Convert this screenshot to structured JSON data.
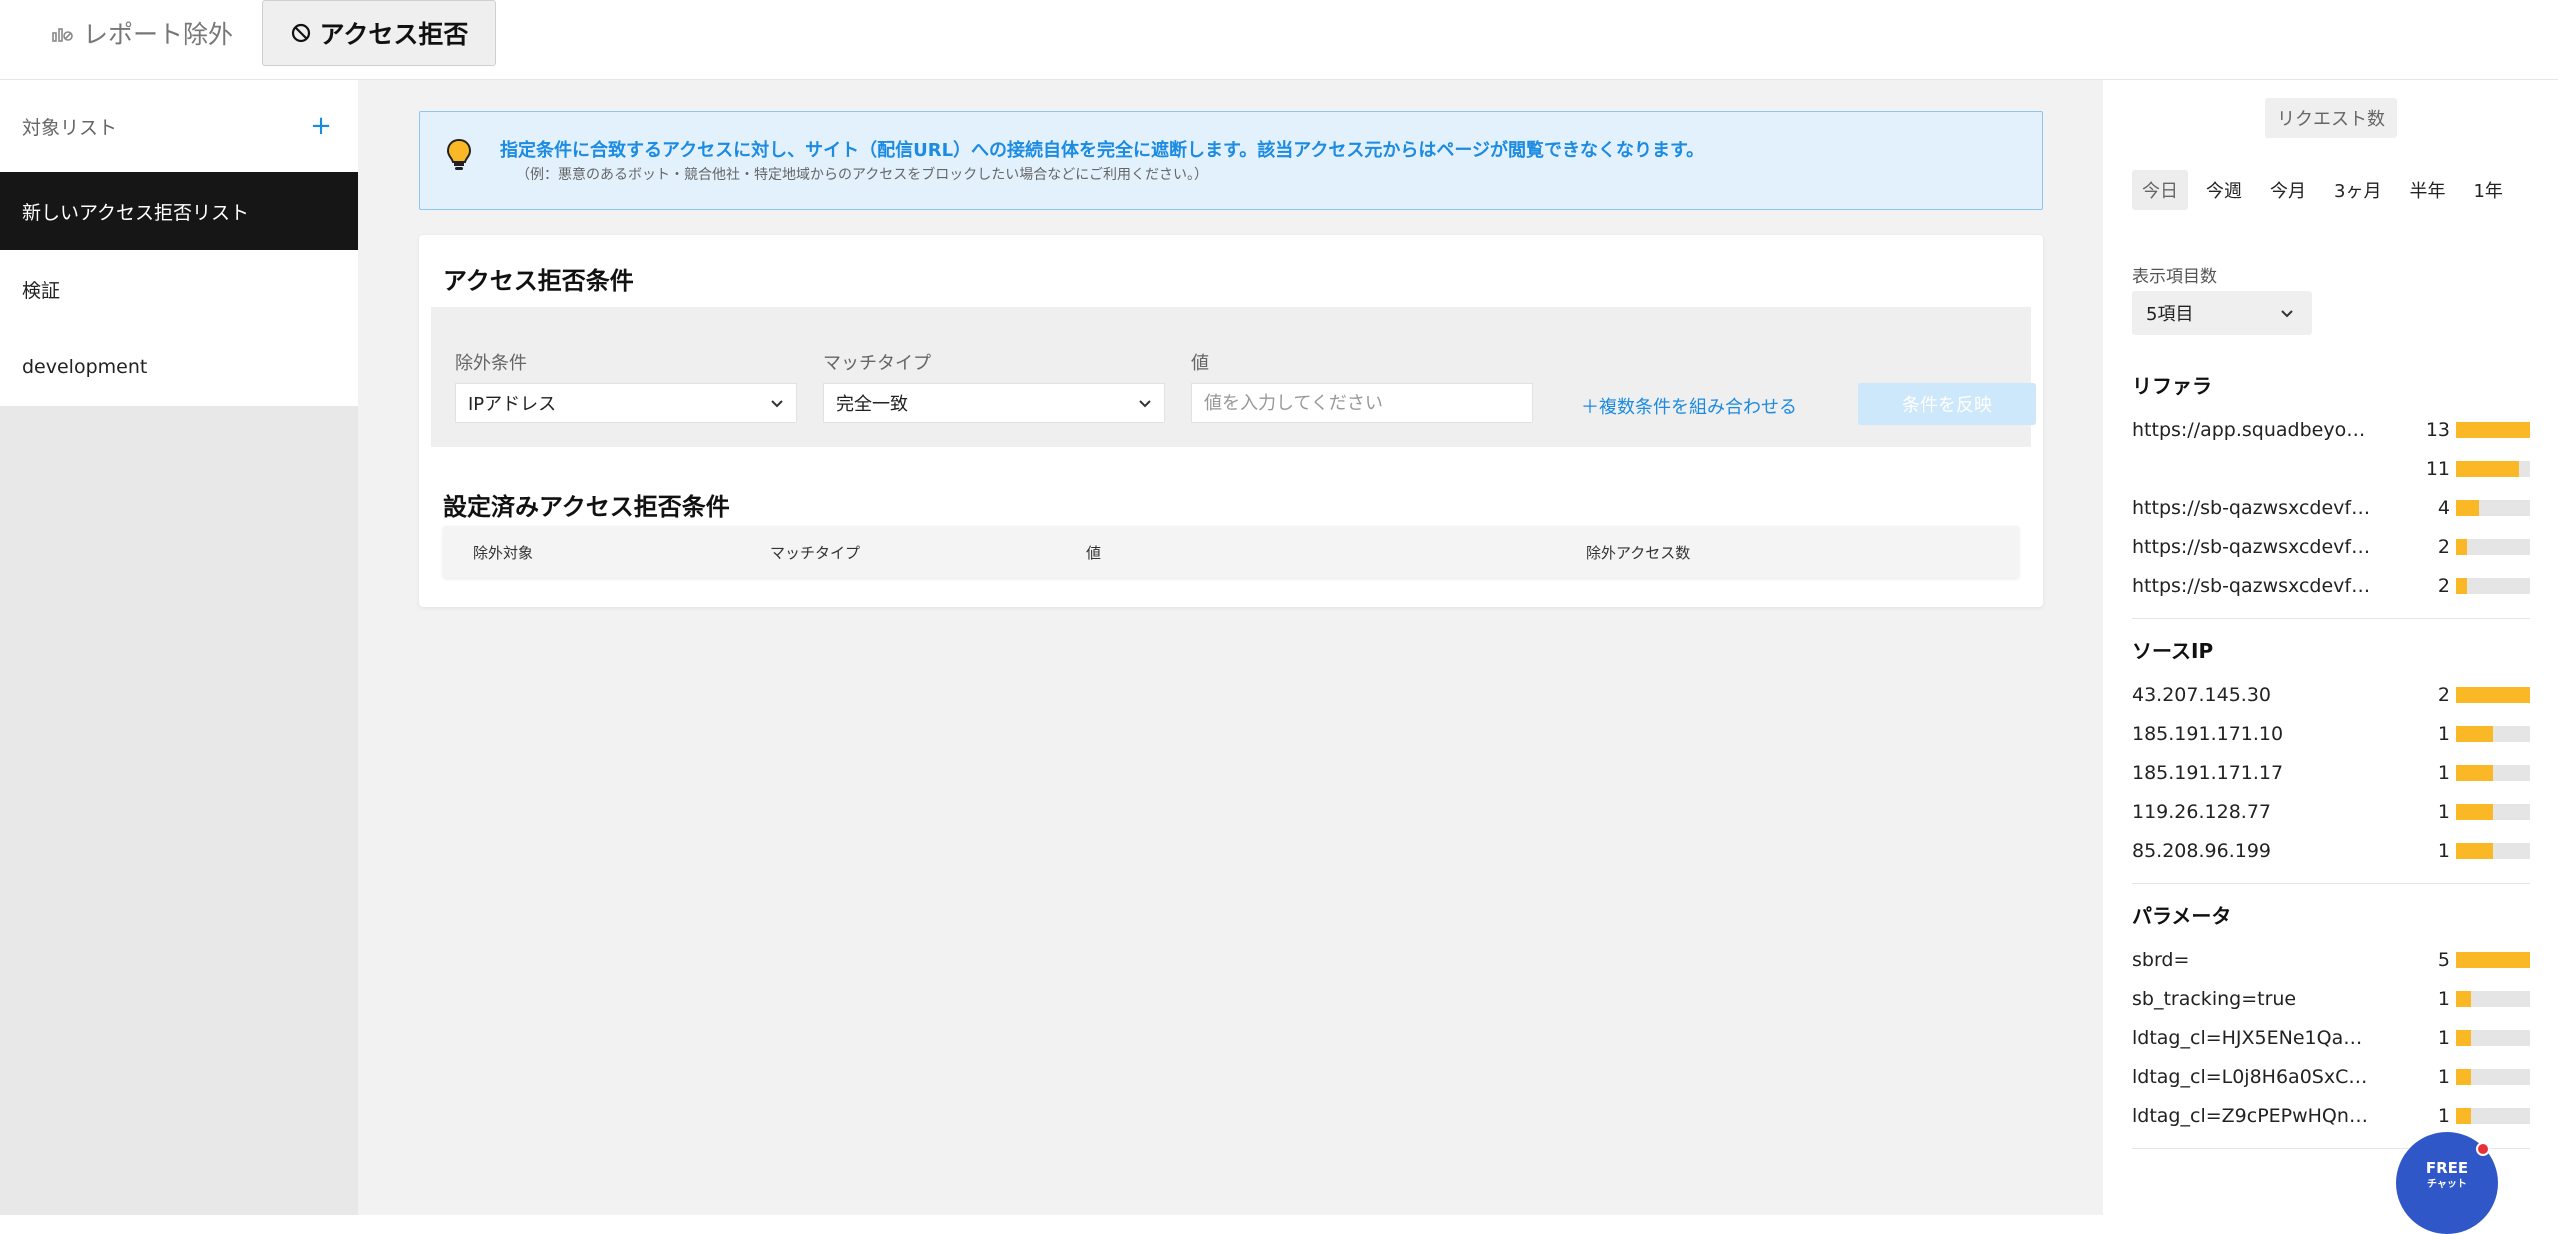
{
  "tabs": {
    "report_exclude": "レポート除外",
    "access_deny": "アクセス拒否"
  },
  "sidebar": {
    "header_label": "対象リスト",
    "add_symbol": "+",
    "items": [
      {
        "label": "新しいアクセス拒否リスト",
        "active": true
      },
      {
        "label": "検証",
        "active": false
      },
      {
        "label": "development",
        "active": false
      }
    ]
  },
  "info": {
    "line1": "指定条件に合致するアクセスに対し、サイト（配信URL）への接続自体を完全に遮断します。該当アクセス元からはページが閲覧できなくなります。",
    "line2": "（例：悪意のあるボット・競合他社・特定地域からのアクセスをブロックしたい場合などにご利用ください。）"
  },
  "conditions": {
    "title": "アクセス拒否条件",
    "exclude_label": "除外条件",
    "exclude_value": "IPアドレス",
    "match_label": "マッチタイプ",
    "match_value": "完全一致",
    "value_label": "値",
    "value_placeholder": "値を入力してください",
    "combine_link": "＋複数条件を組み合わせる",
    "apply_button": "条件を反映"
  },
  "configured": {
    "title": "設定済みアクセス拒否条件",
    "columns": [
      "除外対象",
      "マッチタイプ",
      "値",
      "除外アクセス数"
    ]
  },
  "right": {
    "request_label": "リクエスト数",
    "periods": [
      "今日",
      "今週",
      "今月",
      "3ヶ月",
      "半年",
      "1年"
    ],
    "active_period": "今日",
    "display_label": "表示項目数",
    "display_value": "5項目",
    "referrer": {
      "title": "リファラ",
      "rows": [
        {
          "label": "https://app.squadbeyond.com/...",
          "count": "13",
          "ratio": 1.0
        },
        {
          "label": "",
          "count": "11",
          "ratio": 0.85
        },
        {
          "label": "https://sb-qazwsxcdevfrbgtnhy...",
          "count": "4",
          "ratio": 0.31
        },
        {
          "label": "https://sb-qazwsxcdevfrbgtnhy...",
          "count": "2",
          "ratio": 0.15
        },
        {
          "label": "https://sb-qazwsxcdevfrbgtnhy...",
          "count": "2",
          "ratio": 0.15
        }
      ]
    },
    "source_ip": {
      "title": "ソースIP",
      "rows": [
        {
          "label": "43.207.145.30",
          "count": "2",
          "ratio": 1.0
        },
        {
          "label": "185.191.171.10",
          "count": "1",
          "ratio": 0.5
        },
        {
          "label": "185.191.171.17",
          "count": "1",
          "ratio": 0.5
        },
        {
          "label": "119.26.128.77",
          "count": "1",
          "ratio": 0.5
        },
        {
          "label": "85.208.96.199",
          "count": "1",
          "ratio": 0.5
        }
      ]
    },
    "parameter": {
      "title": "パラメータ",
      "rows": [
        {
          "label": "sbrd=",
          "count": "5",
          "ratio": 1.0
        },
        {
          "label": "sb_tracking=true",
          "count": "1",
          "ratio": 0.2
        },
        {
          "label": "ldtag_cl=HJX5ENe1Qa2XyZwv",
          "count": "1",
          "ratio": 0.2
        },
        {
          "label": "ldtag_cl=L0j8H6a0SxCqLmNr",
          "count": "1",
          "ratio": 0.2
        },
        {
          "label": "ldtag_cl=Z9cPEPwHQnSbVtKo",
          "count": "1",
          "ratio": 0.2
        }
      ]
    }
  },
  "chat": {
    "line1": "FREE",
    "line2": "チャット"
  },
  "colors": {
    "accent": "#1c8be2",
    "bar_fill": "#fbb826",
    "bar_track": "#e5e5e5",
    "active_sidebar": "#161616",
    "chat_bg": "#2f57c7"
  }
}
